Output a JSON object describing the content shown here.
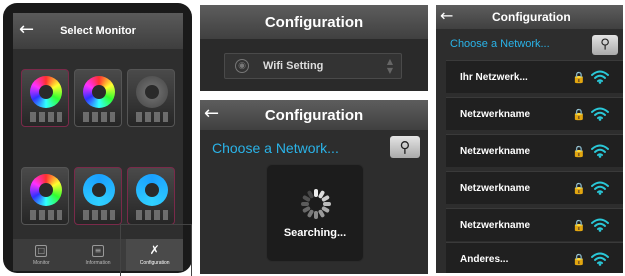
{
  "monitor": {
    "title": "Select Monitor",
    "tabs": [
      {
        "label": "Monitor",
        "icon": "monitor-icon"
      },
      {
        "label": "Information",
        "icon": "information-icon"
      },
      {
        "label": "Configuration",
        "icon": "tools-icon"
      }
    ],
    "active_tab": "Configuration"
  },
  "config_wifi": {
    "title": "Configuration",
    "wifi_setting_label": "Wifi Setting"
  },
  "config_search": {
    "title": "Configuration",
    "choose_label": "Choose a Network...",
    "status": "Searching..."
  },
  "network_list": {
    "title": "Configuration",
    "choose_label": "Choose a Network...",
    "networks": [
      {
        "name": "Ihr Netzwerk..."
      },
      {
        "name": "Netzwerkname"
      },
      {
        "name": "Netzwerkname"
      },
      {
        "name": "Netzwerkname"
      },
      {
        "name": "Netzwerkname"
      },
      {
        "name": "Anderes..."
      }
    ]
  },
  "colors": {
    "accent_blue": "#2ab3e8",
    "wifi_teal": "#2ac8d8",
    "header_gray": "#4a4a4a"
  }
}
